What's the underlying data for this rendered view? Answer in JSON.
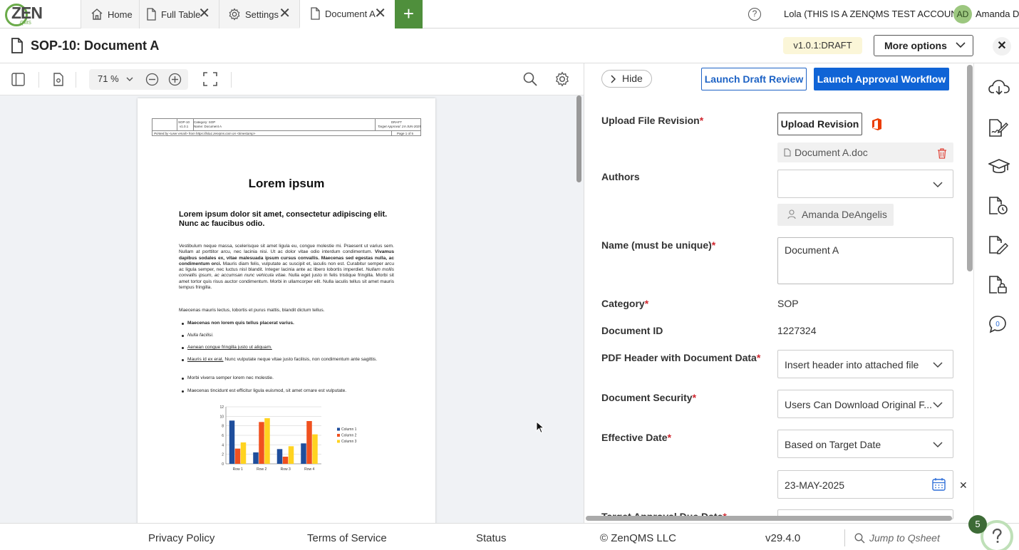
{
  "topbar": {
    "logo_text": "ZEN",
    "logo_sub": "QMS",
    "tabs": [
      {
        "label": "Home",
        "icon": "home-icon"
      },
      {
        "label": "Full Table",
        "icon": "document-icon"
      },
      {
        "label": "Settings",
        "icon": "gear-icon"
      },
      {
        "label": "Document A",
        "icon": "document-icon"
      }
    ],
    "add_tab": "+",
    "help_icon": "?",
    "account": "Lola (THIS IS A ZENQMS TEST ACCOUNT)",
    "avatar_initials": "AD",
    "user_name": "Amanda D"
  },
  "doc_header": {
    "title": "SOP-10: Document A",
    "version_badge": "v1.0.1:DRAFT",
    "more_options": "More options",
    "close": "✕"
  },
  "viewer": {
    "zoom": "71",
    "zoom_unit": "%",
    "page": {
      "hdr_id": "SOP-10",
      "hdr_ver": "v1.0.1",
      "hdr_cat": "Category: SOP",
      "hdr_name": "Name: Document A",
      "hdr_status": "DRAFT",
      "hdr_target": "Target Approval: 24-JUN-2025",
      "hdr_printed": "Printed by <user email> from https://lola1.zenqms.com on <timestamp>",
      "hdr_page": "Page 1 of 5",
      "title": "Lorem ipsum",
      "subtitle": "Lorem ipsum dolor sit amet, consectetur adipiscing elit. Nunc ac faucibus odio.",
      "para1_a": "Vestibulum neque massa, scelerisque sit amet ligula eu, congue molestie mi. Praesent ut varius sem. Nullam at porttitor arcu, nec lacinia nisi. Ut ac dolor vitae odio interdum condimentum. ",
      "para1_b": "Vivamus dapibus sodales ex, vitae malesuada ipsum cursus convallis. Maecenas sed egestas nulla, ac condimentum orci.",
      "para1_c": " Mauris diam felis, vulputate ac suscipit et, iaculis non est. Curabitur semper arcu ac ligula semper, nec luctus nisl blandit. Integer lacinia ante ac libero lobortis imperdiet. ",
      "para1_d": "Nullam mollis convallis ipsum, ac accumsan nunc vehicula vitae.",
      "para1_e": " Nulla eget justo in felis tristique fringilla. Morbi sit amet tortor quis risus auctor condimentum. Morbi in ullamcorper elit. Nulla iaculis tellus sit amet mauris tempus fringilla.",
      "para2": "Maecenas mauris lectus, lobortis et purus mattis, blandit dictum tellus.",
      "bullet1": "Maecenas non lorem quis tellus placerat varius.",
      "bullet2": "Nulla facilisi.",
      "bullet3": "Aenean congue fringilla justo ut aliquam.",
      "bullet4_a": "Mauris id ex erat.",
      "bullet4_b": " Nunc vulputate neque vitae justo facilisis, non condimentum ante sagittis.",
      "bullet5": "Morbi viverra semper lorem nec molestie.",
      "bullet6": "Maecenas tincidunt est efficitur ligula euismod, sit amet ornare est vulputate."
    }
  },
  "chart_data": {
    "type": "bar",
    "categories": [
      "Row 1",
      "Row 2",
      "Row 3",
      "Row 4"
    ],
    "series": [
      {
        "name": "Column 1",
        "values": [
          9.1,
          2.4,
          3.1,
          4.3
        ],
        "color": "#1f4e9c"
      },
      {
        "name": "Column 2",
        "values": [
          3.2,
          8.8,
          1.5,
          9.0
        ],
        "color": "#f0511f"
      },
      {
        "name": "Column 3",
        "values": [
          4.5,
          9.6,
          3.7,
          6.2
        ],
        "color": "#ffd320"
      }
    ],
    "yticks": [
      "0",
      "2",
      "4",
      "6",
      "8",
      "10",
      "12"
    ],
    "ylim": [
      0,
      12
    ],
    "grid": true,
    "legend": "right"
  },
  "panel": {
    "hide": "Hide",
    "launch_draft": "Launch Draft Review",
    "launch_approval": "Launch Approval Workflow",
    "upload_label": "Upload File Revision",
    "upload_button": "Upload Revision",
    "file_name": "Document A.doc",
    "authors_label": "Authors",
    "author_chip": "Amanda DeAngelis",
    "name_label": "Name (must be unique)",
    "name_value": "Document A",
    "category_label": "Category",
    "category_value": "SOP",
    "docid_label": "Document ID",
    "docid_value": "1227324",
    "pdfheader_label": "PDF Header with Document Data",
    "pdfheader_value": "Insert header into attached file",
    "security_label": "Document Security",
    "security_value": "Users Can Download Original F...",
    "effdate_label": "Effective Date",
    "effdate_value": "Based on Target Date",
    "date_value": "23-MAY-2025",
    "next_label": "Target Approval Due Date",
    "req": "*"
  },
  "rail": {
    "chat_count": "0",
    "notification_count": "5",
    "help_fab": "?"
  },
  "footer": {
    "privacy": "Privacy Policy",
    "terms": "Terms of Service",
    "status": "Status",
    "copyright": "© ZenQMS LLC",
    "version": "v29.4.0",
    "jump_placeholder": "Jump to Qsheet"
  },
  "colors": {
    "brand_green": "#4f8f3c",
    "primary_blue": "#1064d6",
    "required_red": "#d0262e",
    "office_orange": "#eb3c00"
  }
}
